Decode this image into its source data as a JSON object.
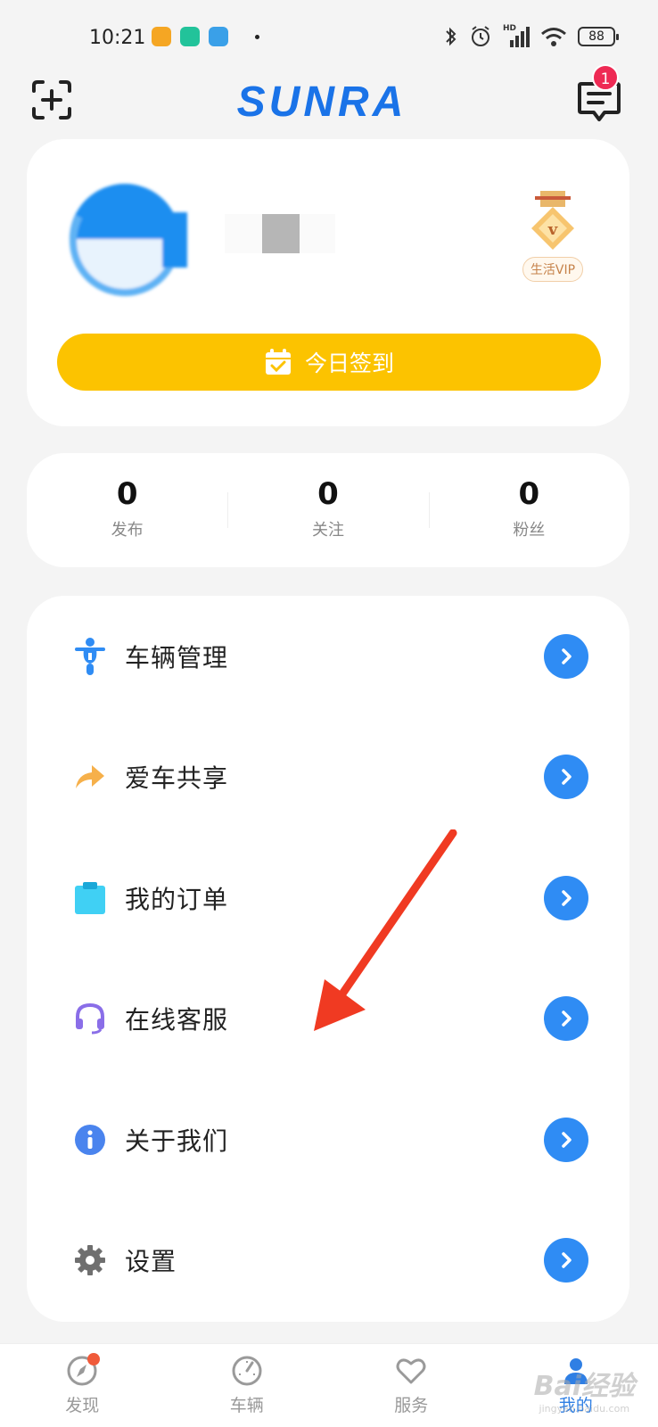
{
  "status_bar": {
    "time": "10:21",
    "battery": "88",
    "network": "HD"
  },
  "header": {
    "logo_text": "SUNRA",
    "message_badge": "1",
    "brand_color": "#1a73e8"
  },
  "profile": {
    "vip_label": "生活VIP",
    "checkin_label": "今日签到",
    "checkin_color": "#fcc300"
  },
  "stats": [
    {
      "value": "0",
      "label": "发布"
    },
    {
      "value": "0",
      "label": "关注"
    },
    {
      "value": "0",
      "label": "粉丝"
    }
  ],
  "menu": [
    {
      "label": "车辆管理",
      "icon": "scooter-icon"
    },
    {
      "label": "爱车共享",
      "icon": "share-arrow-icon"
    },
    {
      "label": "我的订单",
      "icon": "clipboard-icon"
    },
    {
      "label": "在线客服",
      "icon": "headset-icon"
    },
    {
      "label": "关于我们",
      "icon": "info-icon"
    },
    {
      "label": "设置",
      "icon": "gear-icon"
    }
  ],
  "bottom_nav": [
    {
      "label": "发现",
      "icon": "compass-icon",
      "active": false
    },
    {
      "label": "车辆",
      "icon": "speedometer-icon",
      "active": false
    },
    {
      "label": "服务",
      "icon": "heart-icon",
      "active": false
    },
    {
      "label": "我的",
      "icon": "user-icon",
      "active": true
    }
  ],
  "watermark": {
    "text": "Bai经验",
    "sub": "jingyan.baidu.com"
  }
}
